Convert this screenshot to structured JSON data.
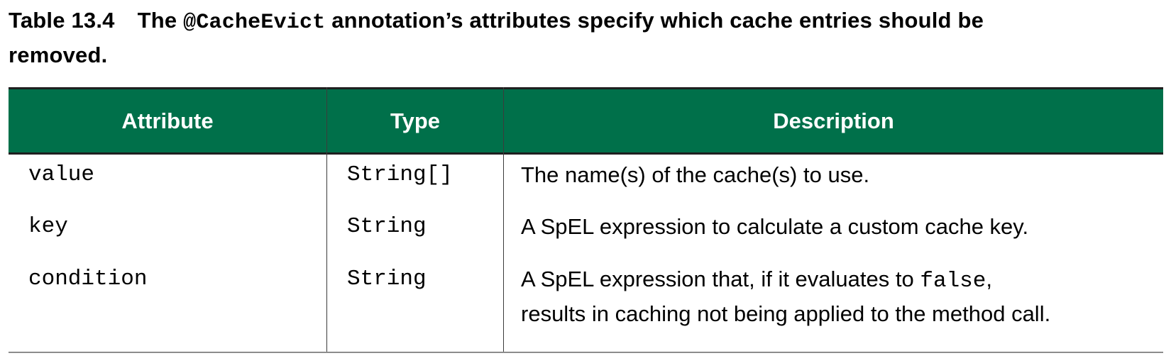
{
  "caption": {
    "number": "Table 13.4",
    "prefix": "The ",
    "code": "@CacheEvict",
    "line1_rest": " annotation’s attributes specify which cache entries should be",
    "line2": "removed."
  },
  "table": {
    "headers": {
      "attribute": "Attribute",
      "type": "Type",
      "description": "Description"
    },
    "rows": [
      {
        "attribute": "value",
        "type": "String[]",
        "description": "The name(s) of the cache(s) to use."
      },
      {
        "attribute": "key",
        "type": "String",
        "description": "A SpEL expression to calculate a custom cache key."
      },
      {
        "attribute": "condition",
        "type": "String",
        "description_part1": "A SpEL expression that, if it evaluates to ",
        "description_code": "false",
        "description_part2": ",",
        "description_line2": "results in caching not being applied to the method call."
      }
    ]
  },
  "colors": {
    "header_bg": "#00704a",
    "header_text": "#ffffff"
  }
}
